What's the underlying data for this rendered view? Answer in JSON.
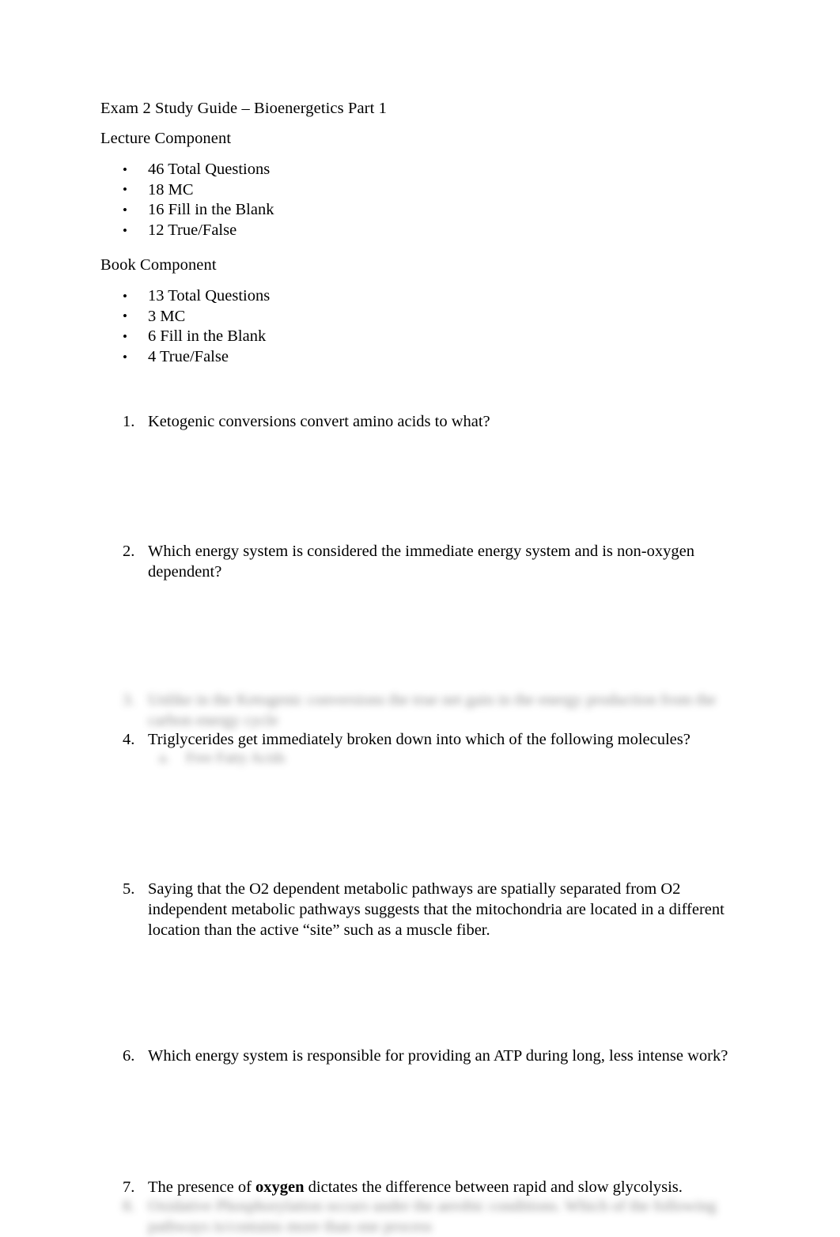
{
  "document": {
    "title": "Exam 2 Study Guide – Bioenergetics Part 1",
    "sections": [
      {
        "heading": "Lecture Component",
        "bullets": [
          "46 Total Questions",
          "18 MC",
          "16 Fill in the Blank",
          "12 True/False"
        ]
      },
      {
        "heading": "Book Component",
        "bullets": [
          "13 Total Questions",
          "3 MC",
          "6 Fill in the Blank",
          "4 True/False"
        ]
      }
    ],
    "questions": [
      {
        "number": "1.",
        "text": "Ketogenic conversions convert amino acids to what?",
        "state": "visible"
      },
      {
        "number": "2.",
        "text": "Which energy system is considered the immediate energy system and is non-oxygen dependent?",
        "state": "visible"
      },
      {
        "number": "3.",
        "text": "Unlike in the Ketogenic conversions the true net gain in the energy production from the carbon energy cycle",
        "state": "blurred"
      },
      {
        "number": "4.",
        "text": "Triglycerides get immediately broken down into which of the following molecules?",
        "state": "visible",
        "sub_item": {
          "label": "a.",
          "text": "Free Fatty Acids",
          "state": "blurred"
        }
      },
      {
        "number": "5.",
        "text": "Saying that the O2 dependent metabolic pathways are spatially separated from O2 independent metabolic pathways suggests that the mitochondria are located in a different location than the active “site” such as a muscle fiber.",
        "state": "visible"
      },
      {
        "number": "6.",
        "text": "Which energy system is responsible for providing an ATP during long, less intense work?",
        "state": "visible"
      },
      {
        "number": "7.",
        "text_before_bold": "The presence of ",
        "bold_term": "oxygen",
        "text_after_bold": " dictates the difference between rapid and slow glycolysis.",
        "state": "visible"
      },
      {
        "number": "8.",
        "text": "Oxidative Phosphorylation occurs under the aerobic conditions. Which of the following pathways is/contains more than one process",
        "state": "blurred"
      }
    ],
    "bullet_glyph": "•",
    "colors": {
      "page_background": "#ffffff",
      "text": "#000000",
      "blurred_text": "#6f6f6f"
    }
  }
}
